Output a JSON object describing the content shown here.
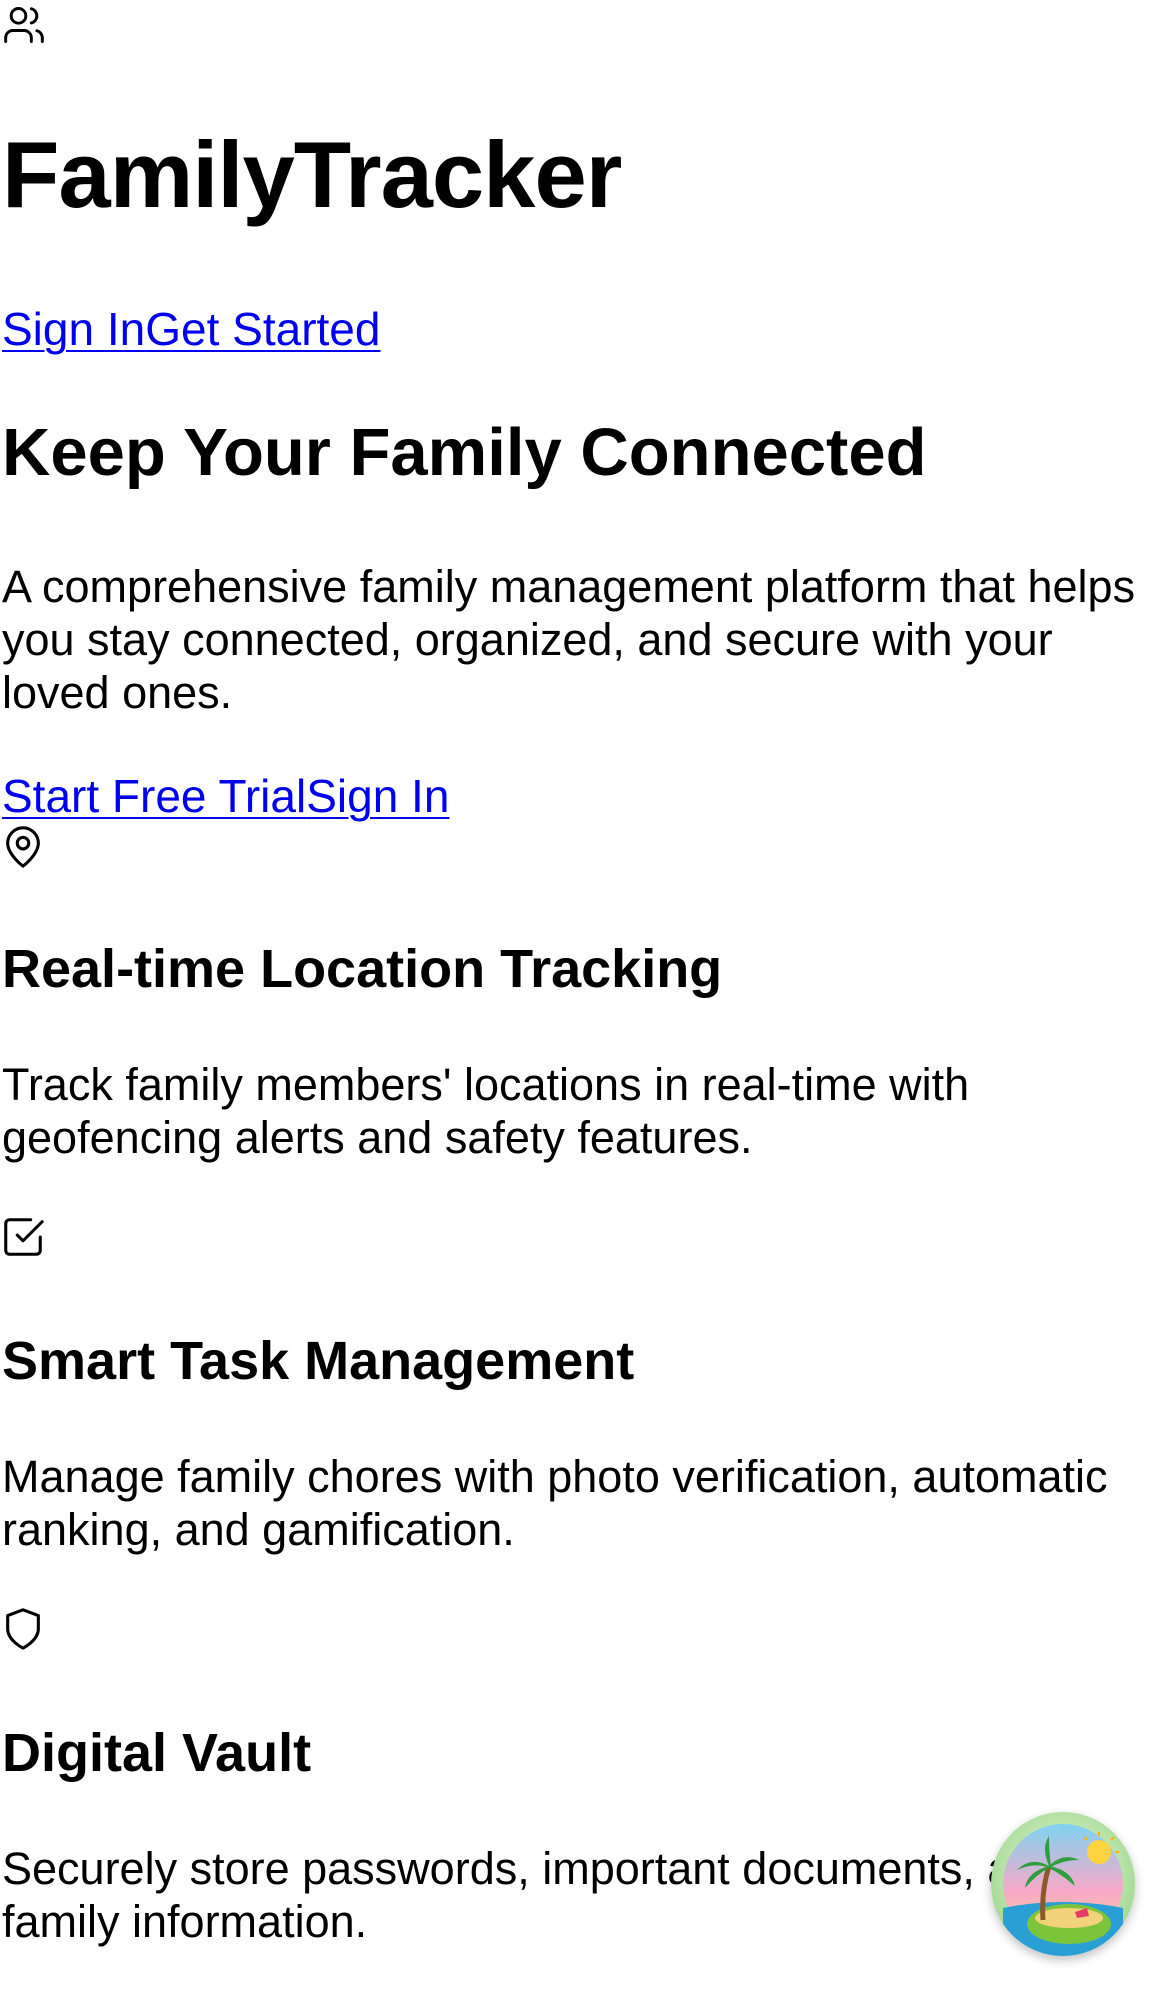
{
  "header": {
    "logo_icon": "users-icon",
    "brand": "FamilyTracker",
    "nav_links": [
      "Sign In",
      "Get Started"
    ]
  },
  "hero": {
    "title": "Keep Your Family Connected",
    "description": "A comprehensive family management platform that helps you stay connected, organized, and secure with your loved ones.",
    "cta_links": [
      "Start Free Trial",
      "Sign In"
    ]
  },
  "features": [
    {
      "icon": "map-pin-icon",
      "title": "Real-time Location Tracking",
      "description": "Track family members' locations in real-time with geofencing alerts and safety features."
    },
    {
      "icon": "check-square-icon",
      "title": "Smart Task Management",
      "description": "Manage family chores with photo verification, automatic ranking, and gamification."
    },
    {
      "icon": "shield-icon",
      "title": "Digital Vault",
      "description": "Securely store passwords, important documents, and family information."
    }
  ],
  "floating_button": {
    "icon": "palm-island-icon"
  },
  "colors": {
    "link": "#0000ee",
    "text": "#000000",
    "background": "#ffffff"
  }
}
